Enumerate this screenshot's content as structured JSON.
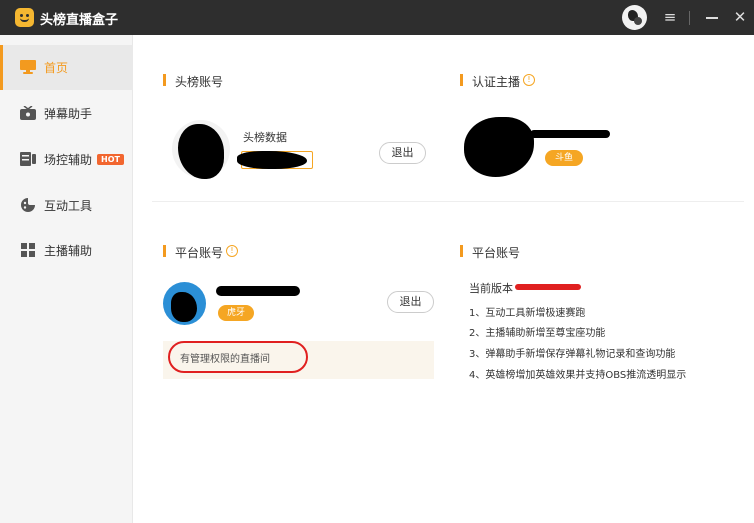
{
  "titlebar": {
    "app_title": "头榜直播盒子",
    "logo_icon": "smiley-box-icon",
    "menu_glyph": "≡",
    "close_glyph": "✕"
  },
  "sidebar": {
    "items": [
      {
        "label": "首页",
        "icon": "monitor-icon"
      },
      {
        "label": "弹幕助手",
        "icon": "tv-icon"
      },
      {
        "label": "场控辅助",
        "icon": "barrage-icon",
        "badge": "HOT"
      },
      {
        "label": "互动工具",
        "icon": "palette-icon"
      },
      {
        "label": "主播辅助",
        "icon": "grid-icon"
      }
    ]
  },
  "toubang_account": {
    "section_title": "头榜账号",
    "name": "头榜数据",
    "logout_label": "退出"
  },
  "verified_anchor": {
    "section_title": "认证主播",
    "platform_tag": "斗鱼"
  },
  "platform_account": {
    "section_title": "平台账号",
    "platform_tag": "虎牙",
    "logout_label": "退出",
    "admin_rooms_label": "有管理权限的直播间"
  },
  "version_panel": {
    "section_title": "平台账号",
    "current_version_label": "当前版本",
    "notes": [
      "1、互动工具新增极速赛跑",
      "2、主播辅助新增至尊宝座功能",
      "3、弹幕助手新增保存弹幕礼物记录和查询功能",
      "4、英雄榜增加英雄效果并支持OBS推流透明显示"
    ]
  },
  "colors": {
    "accent": "#f39a1f",
    "tag": "#f5a623",
    "hot_badge": "#f2662f",
    "titlebar_bg": "#2e2e2e",
    "highlight_box_bg": "#faf5ec",
    "annotation_red": "#e02020"
  }
}
